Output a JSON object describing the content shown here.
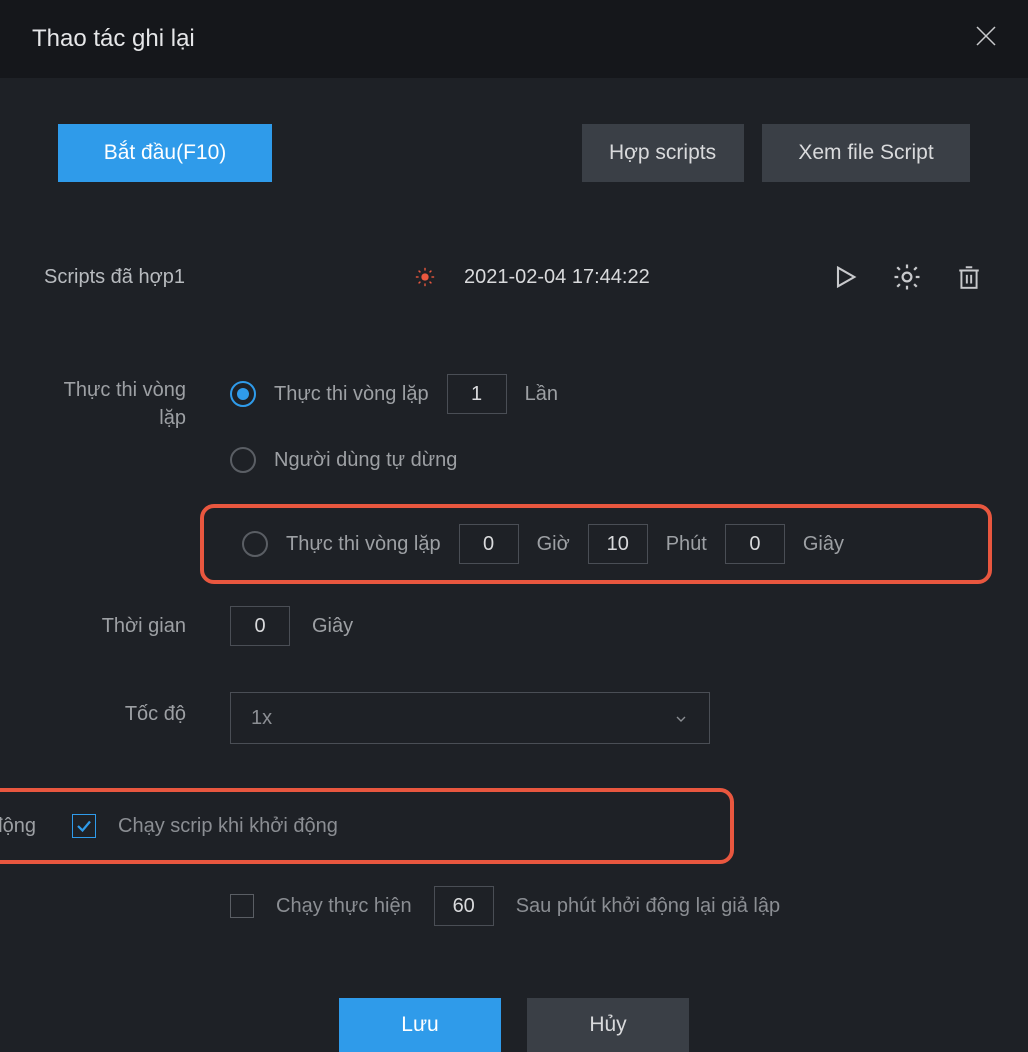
{
  "title": "Thao tác ghi lại",
  "buttons": {
    "start": "Bắt đầu(F10)",
    "merge": "Hợp scripts",
    "view": "Xem file Script",
    "save": "Lưu",
    "cancel": "Hủy"
  },
  "script": {
    "name": "Scripts đã hợp1",
    "timestamp": "2021-02-04 17:44:22"
  },
  "labels": {
    "loop": "Thực thi vòng lặp",
    "time": "Thời gian",
    "speed": "Tốc độ",
    "startup": "Khởi động"
  },
  "options": {
    "loop_count_label": "Thực thi vòng lặp",
    "loop_count_value": "1",
    "loop_count_unit": "Lần",
    "user_stop": "Người dùng tự dừng",
    "loop_time_label": "Thực thi vòng lặp",
    "hours": "0",
    "hours_unit": "Giờ",
    "minutes": "10",
    "minutes_unit": "Phút",
    "seconds": "0",
    "seconds_unit": "Giây",
    "delay_value": "0",
    "delay_unit": "Giây",
    "speed_value": "1x",
    "run_on_start": "Chạy scrip khi khởi động",
    "restart_label": "Chạy thực hiện",
    "restart_value": "60",
    "restart_after": "Sau phút khởi động lại giả lập"
  }
}
